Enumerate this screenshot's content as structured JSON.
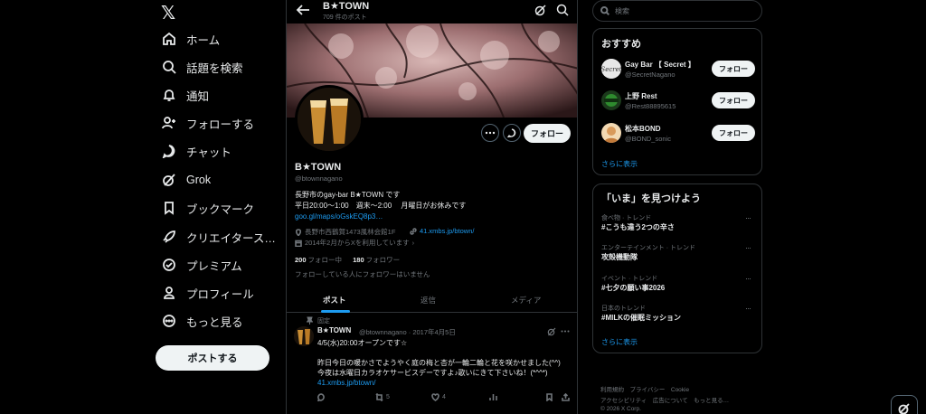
{
  "nav": {
    "logo": "𝕏",
    "items": [
      {
        "label": "ホーム",
        "icon": "home-icon"
      },
      {
        "label": "話題を検索",
        "icon": "search-icon"
      },
      {
        "label": "通知",
        "icon": "bell-icon"
      },
      {
        "label": "フォローする",
        "icon": "add-person-icon"
      },
      {
        "label": "チャット",
        "icon": "chat-icon"
      },
      {
        "label": "Grok",
        "icon": "grok-icon"
      },
      {
        "label": "ブックマーク",
        "icon": "bookmark-icon"
      },
      {
        "label": "クリエイタース…",
        "icon": "rocket-icon"
      },
      {
        "label": "プレミアム",
        "icon": "premium-icon"
      },
      {
        "label": "プロフィール",
        "icon": "person-icon"
      },
      {
        "label": "もっと見る",
        "icon": "more-icon"
      }
    ],
    "post_button": "ポストする"
  },
  "header": {
    "title": "B★TOWN",
    "post_count": "709 件のポスト"
  },
  "profile": {
    "name": "B★TOWN",
    "handle": "@btownnagano",
    "follow_button": "フォロー",
    "bio_line1": "長野市のgay-bar B★TOWN です",
    "bio_line2": "平日20:00〜1:00　週末〜2:00　 月曜日がお休みです",
    "bio_link": "goo.gl/maps/oGskEQ8p3…",
    "location": "長野市西鶴賀1473風林会館1F",
    "website": "41.xmbs.jp/btown/",
    "joined": "2014年2月からXを利用しています",
    "following_count": "200",
    "following_label": "フォロー中",
    "followers_count": "180",
    "followers_label": "フォロワー",
    "mutual_notice": "フォローしている人にフォロワーはいません"
  },
  "tabs": [
    {
      "label": "ポスト",
      "active": true
    },
    {
      "label": "返信",
      "active": false
    },
    {
      "label": "メディア",
      "active": false
    }
  ],
  "tweet": {
    "pinned_label": "固定",
    "name": "B★TOWN",
    "meta": "@btownnagano · 2017年4月5日",
    "line1": "4/5(水)20:00オープンです☆",
    "line2": "",
    "line3": "昨日今日の暖かさでようやく庭の梅と杏が一輪二輪と花を咲かせました(^^)",
    "line4": "今夜は水曜日カラオケサービスデーですよ♪歌いにきて下さいね！(*^^*)",
    "link": "41.xmbs.jp/btown/",
    "retweets": "5",
    "likes": "4"
  },
  "search": {
    "placeholder": "検索"
  },
  "recommend": {
    "title": "おすすめ",
    "users": [
      {
        "name": "Gay Bar 【 Secret 】",
        "handle": "@SecretNagano",
        "button": "フォロー"
      },
      {
        "name": "上野 Rest",
        "handle": "@Rest88895615",
        "button": "フォロー"
      },
      {
        "name": "松本BOND",
        "handle": "@BOND_sonic",
        "button": "フォロー"
      }
    ],
    "show_more": "さらに表示"
  },
  "trends": {
    "title": "「いま」を見つけよう",
    "items": [
      {
        "category": "食べ物 · トレンド",
        "title": "#こうも違う2つの辛さ"
      },
      {
        "category": "エンターテインメント · トレンド",
        "title": "攻殻機動隊"
      },
      {
        "category": "イベント · トレンド",
        "title": "#七夕の願い事2026"
      },
      {
        "category": "日本のトレンド",
        "title": "#MILKの催眠ミッション"
      }
    ],
    "show_more": "さらに表示"
  },
  "footer": {
    "line1": "利用規約　プライバシー　Cookie",
    "line2": "アクセシビリティ　広告について　もっと見る…",
    "line3": "© 2026 X Corp."
  },
  "colors": {
    "accent": "#1d9bf0",
    "background": "#000000",
    "border": "#2f3336",
    "muted": "#71767b"
  }
}
